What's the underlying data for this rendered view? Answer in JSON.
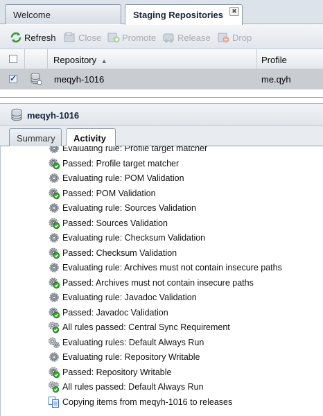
{
  "tabs": [
    {
      "label": "Welcome",
      "active": false
    },
    {
      "label": "Staging Repositories",
      "active": true,
      "close": "✖"
    }
  ],
  "toolbar": {
    "refresh": "Refresh",
    "close": "Close",
    "promote": "Promote",
    "release": "Release",
    "drop": "Drop"
  },
  "grid": {
    "columns": {
      "repository": "Repository",
      "sort_indicator": "▲",
      "profile": "Profile"
    },
    "row": {
      "repository": "meqyh-1016",
      "profile": "me.qyh",
      "checked": true
    }
  },
  "detail": {
    "title": "meqyh-1016",
    "tabs": [
      {
        "label": "Summary",
        "active": false
      },
      {
        "label": "Activity",
        "active": true
      }
    ]
  },
  "activity": [
    {
      "icon": "gear-icon",
      "text": "Evaluating rule: Profile target matcher"
    },
    {
      "icon": "gear-check-icon",
      "text": "Passed: Profile target matcher"
    },
    {
      "icon": "gear-icon",
      "text": "Evaluating rule: POM Validation"
    },
    {
      "icon": "gear-check-icon",
      "text": "Passed: POM Validation"
    },
    {
      "icon": "gear-icon",
      "text": "Evaluating rule: Sources Validation"
    },
    {
      "icon": "gear-check-icon",
      "text": "Passed: Sources Validation"
    },
    {
      "icon": "gear-icon",
      "text": "Evaluating rule: Checksum Validation"
    },
    {
      "icon": "gear-check-icon",
      "text": "Passed: Checksum Validation"
    },
    {
      "icon": "gear-icon",
      "text": "Evaluating rule: Archives must not contain insecure paths"
    },
    {
      "icon": "gear-check-icon",
      "text": "Passed: Archives must not contain insecure paths"
    },
    {
      "icon": "gear-icon",
      "text": "Evaluating rule: Javadoc Validation"
    },
    {
      "icon": "gear-check-icon",
      "text": "Passed: Javadoc Validation"
    },
    {
      "icon": "gears-check-icon",
      "text": "All rules passed: Central Sync Requirement"
    },
    {
      "icon": "gears-icon",
      "text": "Evaluating rules: Default Always Run"
    },
    {
      "icon": "gear-icon",
      "text": "Evaluating rule: Repository Writable"
    },
    {
      "icon": "gear-check-icon",
      "text": "Passed: Repository Writable"
    },
    {
      "icon": "gears-check-icon",
      "text": "All rules passed: Default Always Run"
    },
    {
      "icon": "copy-icon",
      "text": "Copying items from meqyh-1016 to releases"
    }
  ]
}
